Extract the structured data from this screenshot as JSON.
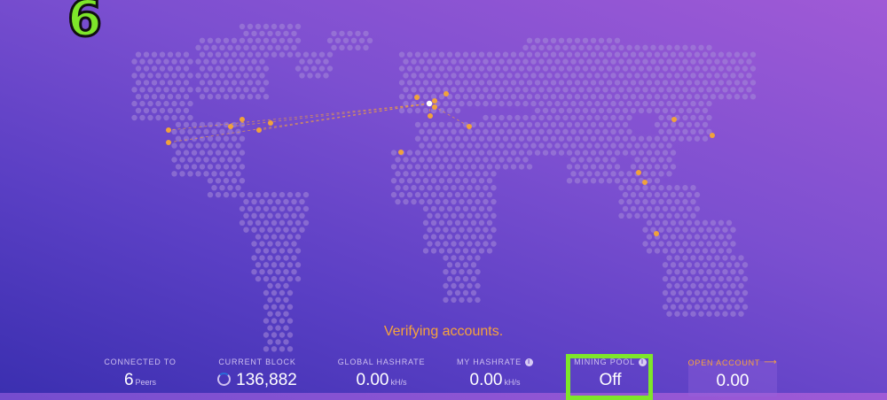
{
  "overlay": {
    "step_number": "6"
  },
  "status_text": "Verifying accounts.",
  "colors": {
    "node": "#f0a23c",
    "self_node": "#ffffff",
    "land_dots": "#a58ad8",
    "highlight": "#7ee62a",
    "accent_orange": "#f6a33c"
  },
  "stats": {
    "connected": {
      "label": "CONNECTED TO",
      "value": "6",
      "unit": "Peers"
    },
    "block": {
      "label": "CURRENT BLOCK",
      "value": "136,882",
      "icon": "spinner-icon"
    },
    "global_hashrate": {
      "label": "GLOBAL HASHRATE",
      "value": "0.00",
      "unit": "kH/s"
    },
    "my_hashrate": {
      "label": "MY HASHRATE",
      "value": "0.00",
      "unit": "kH/s",
      "icon": "info-icon"
    },
    "mining_pool": {
      "label": "MINING POOL",
      "value": "Off",
      "icon": "info-icon"
    },
    "open_account": {
      "label": "OPEN ACCOUNT",
      "value": "0.00",
      "icon": "arrow-right-icon"
    }
  }
}
